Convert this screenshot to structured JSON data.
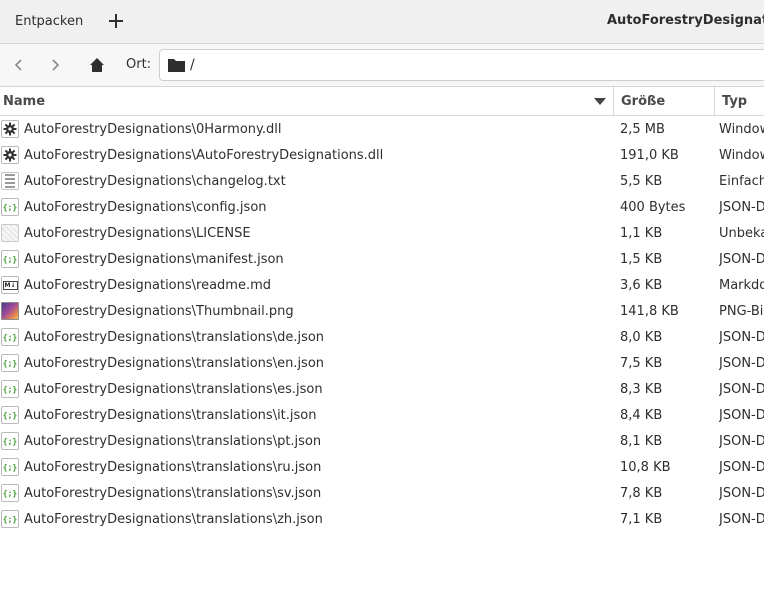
{
  "header": {
    "extract_label": "Entpacken",
    "add_icon": "plus-icon",
    "title": "AutoForestryDesignations"
  },
  "location": {
    "label": "Ort:",
    "path": "/"
  },
  "columns": {
    "name": "Name",
    "size": "Größe",
    "type": "Typ"
  },
  "files": [
    {
      "icon": "gear-icon",
      "name": "AutoForestryDesignations\\0Harmony.dll",
      "size": "2,5 MB",
      "type": "Windows"
    },
    {
      "icon": "gear-icon",
      "name": "AutoForestryDesignations\\AutoForestryDesignations.dll",
      "size": "191,0 KB",
      "type": "Windows"
    },
    {
      "icon": "text-file-icon",
      "name": "AutoForestryDesignations\\changelog.txt",
      "size": "5,5 KB",
      "type": "Einfache"
    },
    {
      "icon": "json-file-icon",
      "name": "AutoForestryDesignations\\config.json",
      "size": "400 Bytes",
      "type": "JSON-D"
    },
    {
      "icon": "unknown-file-icon",
      "name": "AutoForestryDesignations\\LICENSE",
      "size": "1,1 KB",
      "type": "Unbeka"
    },
    {
      "icon": "json-file-icon",
      "name": "AutoForestryDesignations\\manifest.json",
      "size": "1,5 KB",
      "type": "JSON-D"
    },
    {
      "icon": "markdown-file-icon",
      "name": "AutoForestryDesignations\\readme.md",
      "size": "3,6 KB",
      "type": "Markdo"
    },
    {
      "icon": "image-file-icon",
      "name": "AutoForestryDesignations\\Thumbnail.png",
      "size": "141,8 KB",
      "type": "PNG-Bil"
    },
    {
      "icon": "json-file-icon",
      "name": "AutoForestryDesignations\\translations\\de.json",
      "size": "8,0 KB",
      "type": "JSON-D"
    },
    {
      "icon": "json-file-icon",
      "name": "AutoForestryDesignations\\translations\\en.json",
      "size": "7,5 KB",
      "type": "JSON-D"
    },
    {
      "icon": "json-file-icon",
      "name": "AutoForestryDesignations\\translations\\es.json",
      "size": "8,3 KB",
      "type": "JSON-D"
    },
    {
      "icon": "json-file-icon",
      "name": "AutoForestryDesignations\\translations\\it.json",
      "size": "8,4 KB",
      "type": "JSON-D"
    },
    {
      "icon": "json-file-icon",
      "name": "AutoForestryDesignations\\translations\\pt.json",
      "size": "8,1 KB",
      "type": "JSON-D"
    },
    {
      "icon": "json-file-icon",
      "name": "AutoForestryDesignations\\translations\\ru.json",
      "size": "10,8 KB",
      "type": "JSON-D"
    },
    {
      "icon": "json-file-icon",
      "name": "AutoForestryDesignations\\translations\\sv.json",
      "size": "7,8 KB",
      "type": "JSON-D"
    },
    {
      "icon": "json-file-icon",
      "name": "AutoForestryDesignations\\translations\\zh.json",
      "size": "7,1 KB",
      "type": "JSON-D"
    }
  ]
}
